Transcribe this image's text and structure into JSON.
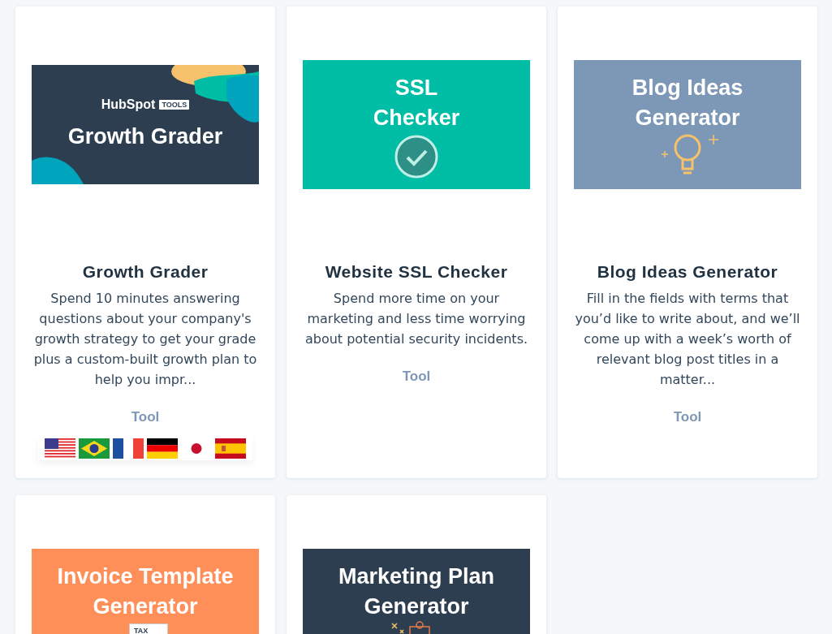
{
  "cards": [
    {
      "banner": {
        "kind": "growth",
        "color": "#2d3e50",
        "brand": "HubSpot",
        "badge": "TOOLS",
        "lines": [
          "Growth Grader"
        ]
      },
      "title": "Growth Grader",
      "description": "Spend 10 minutes answering questions about your company's growth strategy to get your grade plus a custom-built growth plan to help you impr...",
      "type": "Tool",
      "flags": [
        {
          "kind": "us"
        },
        {
          "kind": "br"
        },
        {
          "kind": "fr"
        },
        {
          "kind": "de"
        },
        {
          "kind": "jp"
        },
        {
          "kind": "es"
        }
      ]
    },
    {
      "banner": {
        "kind": "ssl",
        "color": "#00bda5",
        "lines": [
          "SSL",
          "Checker"
        ]
      },
      "title": "Website SSL Checker",
      "description": "Spend more time on your marketing and less time worrying about potential security incidents.",
      "type": "Tool"
    },
    {
      "banner": {
        "kind": "blog",
        "color": "#7c98b6",
        "lines": [
          "Blog Ideas",
          "Generator"
        ]
      },
      "title": "Blog Ideas Generator",
      "description": "Fill in the fields with terms that you’d like to write about, and we’ll come up with a week’s worth of relevant blog post titles in a matter...",
      "type": "Tool"
    },
    {
      "banner": {
        "kind": "invoice",
        "color": "#ff8f59",
        "lines": [
          "Invoice Template",
          "Generator"
        ],
        "tag": "TAX"
      }
    },
    {
      "banner": {
        "kind": "marketing",
        "color": "#2d3e50",
        "lines": [
          "Marketing Plan",
          "Generator"
        ]
      }
    }
  ]
}
